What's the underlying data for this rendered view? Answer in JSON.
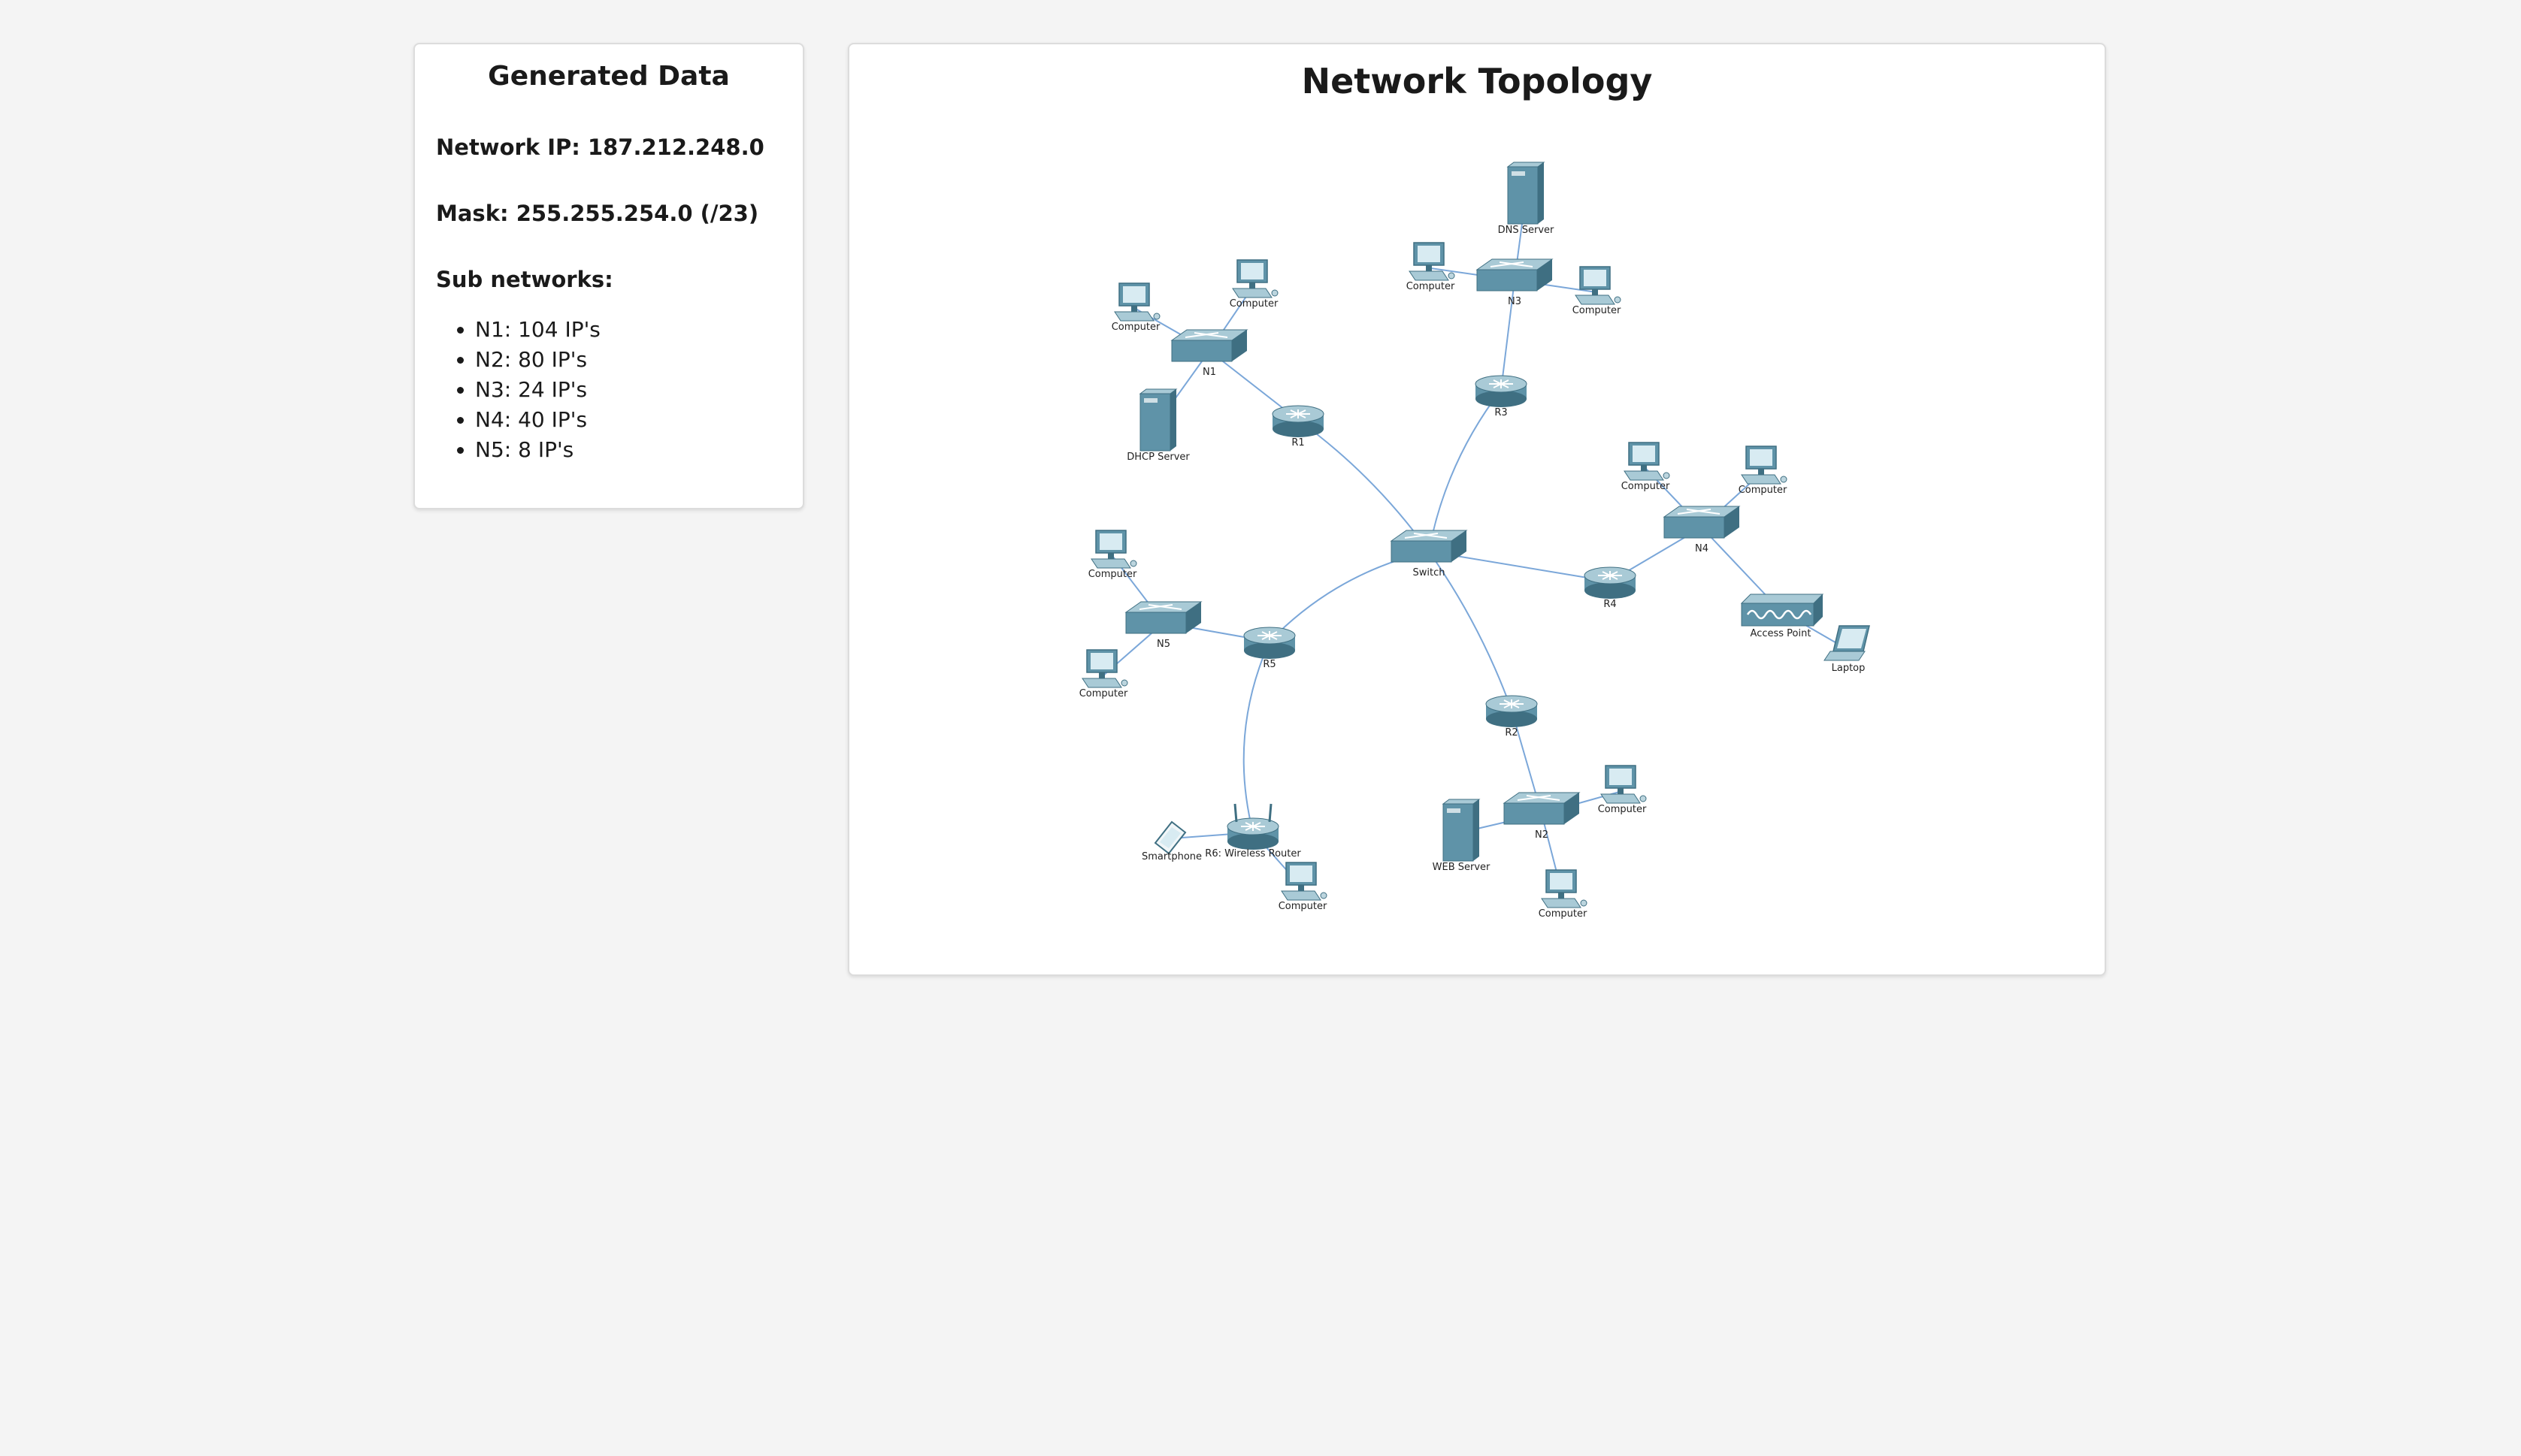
{
  "generated": {
    "title": "Generated Data",
    "network_ip_label": "Network IP:",
    "network_ip": "187.212.248.0",
    "mask_label": "Mask:",
    "mask": "255.255.254.0 (/23)",
    "subnets_label": "Sub networks:",
    "subnets": [
      {
        "name": "N1",
        "ips": "104 IP's"
      },
      {
        "name": "N2",
        "ips": "80 IP's"
      },
      {
        "name": "N3",
        "ips": "24 IP's"
      },
      {
        "name": "N4",
        "ips": "40 IP's"
      },
      {
        "name": "N5",
        "ips": "8 IP's"
      }
    ]
  },
  "topology": {
    "title": "Network Topology",
    "colors": {
      "device": "#5f93a8",
      "link": "#7ba7d9"
    },
    "nodes": {
      "switch": {
        "label": "Switch",
        "type": "switch"
      },
      "r1": {
        "label": "R1",
        "type": "router"
      },
      "r2": {
        "label": "R2",
        "type": "router"
      },
      "r3": {
        "label": "R3",
        "type": "router"
      },
      "r4": {
        "label": "R4",
        "type": "router"
      },
      "r5": {
        "label": "R5",
        "type": "router"
      },
      "r6": {
        "label": "R6: Wireless Router",
        "type": "wireless-router"
      },
      "n1": {
        "label": "N1",
        "type": "switch"
      },
      "n2": {
        "label": "N2",
        "type": "switch"
      },
      "n3": {
        "label": "N3",
        "type": "switch"
      },
      "n4": {
        "label": "N4",
        "type": "switch"
      },
      "n5": {
        "label": "N5",
        "type": "switch"
      },
      "n1_pc1": {
        "label": "Computer",
        "type": "computer"
      },
      "n1_pc2": {
        "label": "Computer",
        "type": "computer"
      },
      "dhcp": {
        "label": "DHCP Server",
        "type": "server"
      },
      "dns": {
        "label": "DNS Server",
        "type": "server"
      },
      "n3_pc1": {
        "label": "Computer",
        "type": "computer"
      },
      "n3_pc2": {
        "label": "Computer",
        "type": "computer"
      },
      "n4_pc1": {
        "label": "Computer",
        "type": "computer"
      },
      "n4_pc2": {
        "label": "Computer",
        "type": "computer"
      },
      "ap": {
        "label": "Access Point",
        "type": "access-point"
      },
      "laptop": {
        "label": "Laptop",
        "type": "laptop"
      },
      "n5_pc1": {
        "label": "Computer",
        "type": "computer"
      },
      "n5_pc2": {
        "label": "Computer",
        "type": "computer"
      },
      "n2_pc1": {
        "label": "Computer",
        "type": "computer"
      },
      "n2_pc2": {
        "label": "Computer",
        "type": "computer"
      },
      "web": {
        "label": "WEB Server",
        "type": "server"
      },
      "phone": {
        "label": "Smartphone",
        "type": "smartphone"
      },
      "r6_pc": {
        "label": "Computer",
        "type": "computer"
      }
    },
    "links": [
      [
        "switch",
        "r1"
      ],
      [
        "switch",
        "r2"
      ],
      [
        "switch",
        "r3"
      ],
      [
        "switch",
        "r4"
      ],
      [
        "switch",
        "r5"
      ],
      [
        "r1",
        "n1"
      ],
      [
        "n1",
        "n1_pc1"
      ],
      [
        "n1",
        "n1_pc2"
      ],
      [
        "n1",
        "dhcp"
      ],
      [
        "r3",
        "n3"
      ],
      [
        "n3",
        "dns"
      ],
      [
        "n3",
        "n3_pc1"
      ],
      [
        "n3",
        "n3_pc2"
      ],
      [
        "r4",
        "n4"
      ],
      [
        "n4",
        "n4_pc1"
      ],
      [
        "n4",
        "n4_pc2"
      ],
      [
        "n4",
        "ap"
      ],
      [
        "ap",
        "laptop"
      ],
      [
        "r5",
        "n5"
      ],
      [
        "n5",
        "n5_pc1"
      ],
      [
        "n5",
        "n5_pc2"
      ],
      [
        "r5",
        "r6"
      ],
      [
        "r6",
        "phone"
      ],
      [
        "r6",
        "r6_pc"
      ],
      [
        "r2",
        "n2"
      ],
      [
        "n2",
        "n2_pc1"
      ],
      [
        "n2",
        "n2_pc2"
      ],
      [
        "n2",
        "web"
      ]
    ]
  }
}
